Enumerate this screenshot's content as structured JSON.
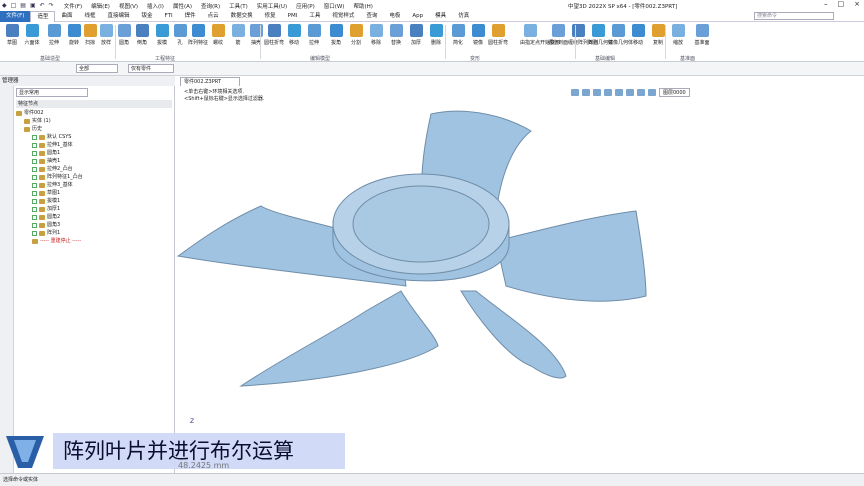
{
  "titlebar": {
    "menus": [
      "文件(F)",
      "编辑(E)",
      "视图(V)",
      "插入(I)",
      "属性(A)",
      "查询(R)",
      "工具(T)",
      "实用工具(U)",
      "应用(P)",
      "窗口(W)",
      "帮助(H)"
    ],
    "window_title": "中望3D 2022X SP x64 - [零件002.Z3PRT]"
  },
  "tabs": [
    "文件(F)",
    "造型",
    "曲面",
    "线框",
    "直接编辑",
    "钣金",
    "FTI",
    "焊件",
    "点云",
    "数据交换",
    "修复",
    "PMI",
    "工具",
    "视觉样式",
    "查询",
    "电极",
    "App",
    "模具",
    "仿真"
  ],
  "search_placeholder": "搜索命令",
  "ribbon": {
    "buttons": [
      "草图",
      "六面体",
      "拉伸",
      "旋转",
      "扫掠",
      "放样",
      "圆角",
      "倒角",
      "拔模",
      "孔",
      "阵列特征",
      "螺纹",
      "筋",
      "抽壳",
      "圆柱折弯",
      "移动",
      "拉伸",
      "拔角",
      "分割",
      "移除",
      "替换",
      "加厚",
      "删除",
      "简化",
      "镜像",
      "圆柱折弯",
      "由指定点开始变形",
      "缠绕到面",
      "缠绕阵列到面",
      "阵列几何体",
      "镜像几何体",
      "移动",
      "复制",
      "缩放",
      "基准面"
    ],
    "groups": [
      "基础造型",
      "工程特征",
      "编辑模型",
      "变形",
      "基础编辑",
      "基准面"
    ]
  },
  "cmdbar": {
    "filter": "全部",
    "part": "仅有零件"
  },
  "left": {
    "title": "管理器",
    "dropdown": "显示常用",
    "feature_header": "特征节点",
    "tree": [
      {
        "label": "零件002",
        "indent": 0
      },
      {
        "label": "实体 (1)",
        "indent": 1
      },
      {
        "label": "历史",
        "indent": 1
      },
      {
        "label": "默认 CSYS",
        "indent": 2
      },
      {
        "label": "拉伸1_基体",
        "indent": 2
      },
      {
        "label": "圆角1",
        "indent": 2
      },
      {
        "label": "抽壳1",
        "indent": 2
      },
      {
        "label": "拉伸2_凸台",
        "indent": 2
      },
      {
        "label": "阵列特征1_凸台",
        "indent": 2
      },
      {
        "label": "拉伸3_基体",
        "indent": 2
      },
      {
        "label": "草图1",
        "indent": 2
      },
      {
        "label": "拔模1",
        "indent": 2
      },
      {
        "label": "加厚1",
        "indent": 2
      },
      {
        "label": "圆角2",
        "indent": 2
      },
      {
        "label": "圆角3",
        "indent": 2
      },
      {
        "label": "阵列1",
        "indent": 2
      },
      {
        "label": "----- 重建停止 -----",
        "indent": 2,
        "red": true
      }
    ]
  },
  "viewport": {
    "doc_tab": "零件002.Z3PRT",
    "hint1": "<单击右键>环境相关选项.",
    "hint2": "<Shift+鼠标右键>显示选择过滤器.",
    "layer": "图层0000",
    "select": "单一选择"
  },
  "caption": "阵列叶片并进行布尔运算",
  "measure": "48.2425 mm",
  "status": "选择命令或实体",
  "colors": {
    "accent": "#2f6fbf",
    "part": "#9fc3e0"
  }
}
